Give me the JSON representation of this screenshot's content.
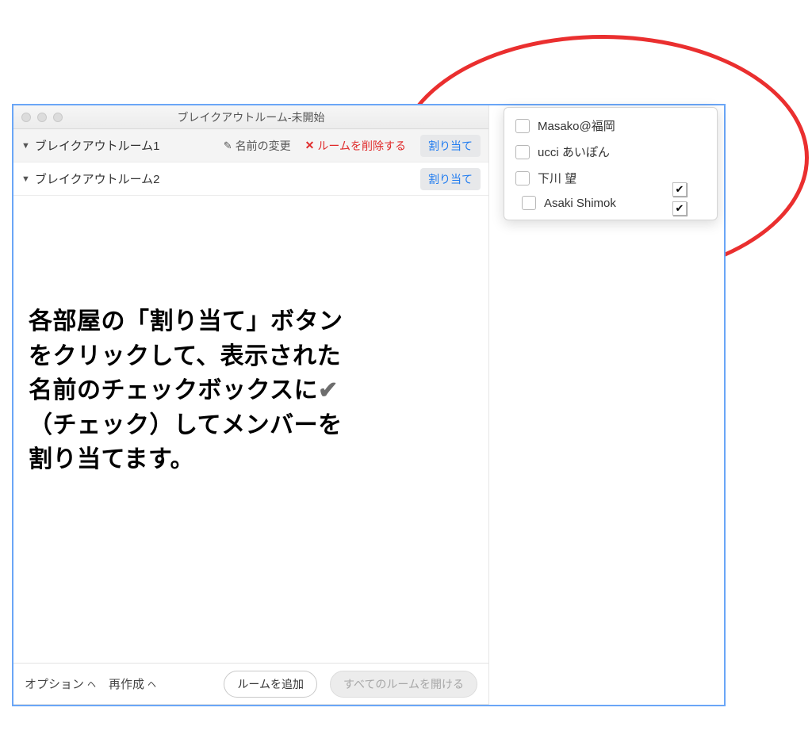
{
  "window": {
    "title": "ブレイクアウトルーム-未開始"
  },
  "rooms": [
    {
      "name": "ブレイクアウトルーム1",
      "rename_label": "名前の変更",
      "delete_label": "ルームを削除する",
      "assign_label": "割り当て"
    },
    {
      "name": "ブレイクアウトルーム2",
      "assign_label": "割り当て"
    }
  ],
  "popover": {
    "items": [
      "Masako@福岡",
      "ucci あいぽん",
      "下川 望",
      "Asaki Shimok"
    ]
  },
  "footer": {
    "options_label": "オプション",
    "recreate_label": "再作成",
    "add_room_label": "ルームを追加",
    "open_all_label": "すべてのルームを開ける"
  },
  "annotation": {
    "text_l1": "各部屋の「割り当て」ボタン",
    "text_l2": "をクリックして、表示された",
    "text_l3_a": "名前のチェックボックスに",
    "text_l3_check": "✔",
    "text_l4": "（チェック）してメンバーを",
    "text_l5": "割り当てます。"
  }
}
